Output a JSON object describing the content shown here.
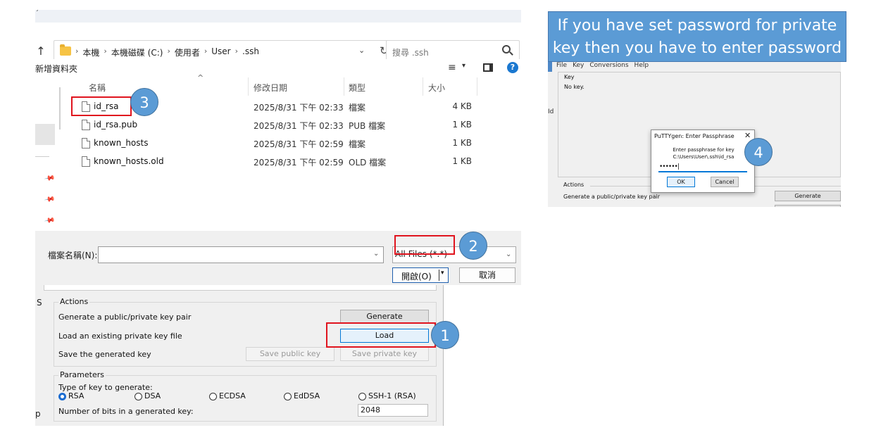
{
  "file_dialog": {
    "top_strip_char": "ˊ",
    "address": {
      "crumbs": [
        "本機",
        "本機磁碟 (C:)",
        "使用者",
        "User",
        ".ssh"
      ],
      "separator": "›",
      "dropdown": "⌄",
      "refresh": "↻"
    },
    "search_placeholder": "搜尋 .ssh",
    "toolbar": {
      "new_folder": "新增資料夾",
      "view_icon": "≡",
      "view_dropdown": "▾",
      "help": "?"
    },
    "columns": {
      "name": "名稱",
      "date": "修改日期",
      "type": "類型",
      "size": "大小"
    },
    "files": [
      {
        "name": "id_rsa",
        "date": "2025/8/31 下午 02:33",
        "type": "檔案",
        "size": "4 KB"
      },
      {
        "name": "id_rsa.pub",
        "date": "2025/8/31 下午 02:33",
        "type": "PUB 檔案",
        "size": "1 KB"
      },
      {
        "name": "known_hosts",
        "date": "2025/8/31 下午 02:59",
        "type": "檔案",
        "size": "1 KB"
      },
      {
        "name": "known_hosts.old",
        "date": "2025/8/31 下午 02:59",
        "type": "OLD 檔案",
        "size": "1 KB"
      }
    ],
    "filename_label": "檔案名稱(N):",
    "filename_value": "",
    "filter_value": "All Files (*.*)",
    "open_label": "開啟(O)",
    "open_split": "▾",
    "cancel_label": "取消",
    "pin_glyph": "📌"
  },
  "putty_main": {
    "side_top": "S",
    "side_bottom": "p",
    "actions_title": "Actions",
    "actions": [
      {
        "label": "Generate a public/private key pair",
        "button": "Generate"
      },
      {
        "label": "Load an existing private key file",
        "button": "Load"
      },
      {
        "label": "Save the generated key",
        "button_public": "Save public key",
        "button_private": "Save private key"
      }
    ],
    "params_title": "Parameters",
    "type_label": "Type of key to generate:",
    "key_types": [
      "RSA",
      "DSA",
      "ECDSA",
      "EdDSA",
      "SSH-1 (RSA)"
    ],
    "selected_key_type": "RSA",
    "bits_label": "Number of bits in a generated key:",
    "bits_value": "2048"
  },
  "callout": {
    "line1": "If you have set password for private",
    "line2": "key then you have to enter password"
  },
  "putty_right": {
    "menu": [
      "File",
      "Key",
      "Conversions",
      "Help"
    ],
    "key_title": "Key",
    "key_text": "No key.",
    "side_id": "Id",
    "actions_title": "Actions",
    "generate_label": "Generate a public/private key pair",
    "generate_button": "Generate",
    "dialog": {
      "title": "PuTTYgen: Enter Passphrase",
      "close": "✕",
      "prompt": "Enter passphrase for key",
      "path": "C:\\Users\\User\\.ssh\\id_rsa",
      "masked_value": "••••••|",
      "ok": "OK",
      "cancel": "Cancel"
    }
  },
  "badges": {
    "load": "1",
    "filter": "2",
    "file": "3",
    "passphrase": "4"
  },
  "colors": {
    "badge": "#5b9bd5",
    "highlight": "#e0141e",
    "callout": "#5b9bd5",
    "accent": "#0078d7"
  }
}
